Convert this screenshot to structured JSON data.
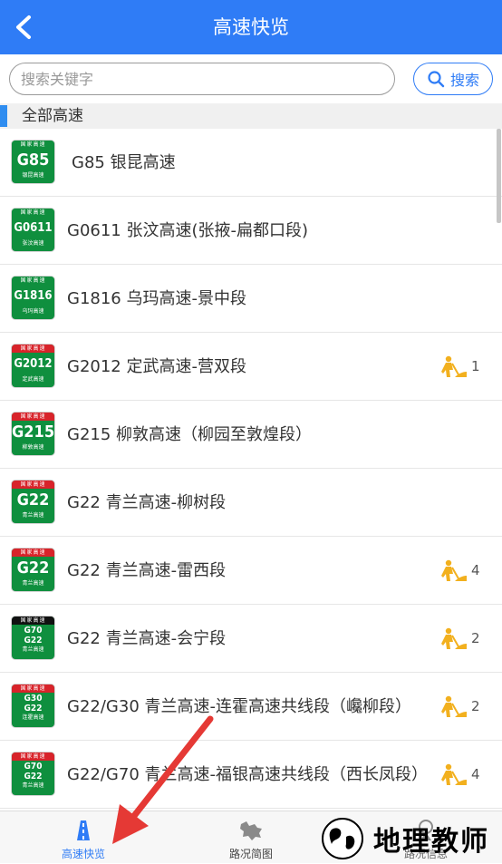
{
  "header": {
    "title": "高速快览",
    "back_icon": "chevron-left-icon"
  },
  "search": {
    "placeholder": "搜索关键字",
    "value": "",
    "button_label": "搜索"
  },
  "section": {
    "title": "全部高速"
  },
  "colors": {
    "primary": "#2f7cf6",
    "shield_green": "#0f8f3e",
    "shield_red": "#d8232a",
    "worker": "#f2b01e",
    "arrow": "#e53935"
  },
  "roads": [
    {
      "name": "G85 银昆高速",
      "badge_top": "国家高速",
      "badge_code": "G85",
      "badge_sub": "银昆高速",
      "incidents": ""
    },
    {
      "name": "G0611 张汶高速(张掖-扁都口段)",
      "badge_top": "国家高速",
      "badge_code": "G0611",
      "badge_sub": "张汶高速",
      "incidents": ""
    },
    {
      "name": "G1816 乌玛高速-景中段",
      "badge_top": "国家高速",
      "badge_code": "G1816",
      "badge_sub": "乌玛高速",
      "incidents": ""
    },
    {
      "name": "G2012 定武高速-营双段",
      "badge_top": "国家高速",
      "badge_code": "G2012",
      "badge_sub": "定武高速",
      "incidents": "1"
    },
    {
      "name": "G215 柳敦高速（柳园至敦煌段）",
      "badge_top": "国家高速",
      "badge_code": "G215",
      "badge_sub": "柳敦高速",
      "incidents": ""
    },
    {
      "name": "G22 青兰高速-柳树段",
      "badge_top": "国家高速",
      "badge_code": "G22",
      "badge_sub": "青兰高速",
      "incidents": ""
    },
    {
      "name": "G22 青兰高速-雷西段",
      "badge_top": "国家高速",
      "badge_code": "G22",
      "badge_sub": "青兰高速",
      "incidents": "4"
    },
    {
      "name": "G22 青兰高速-会宁段",
      "badge_top": "国家高速",
      "badge_code": "G70\nG22",
      "badge_sub": "青兰高速",
      "incidents": "2"
    },
    {
      "name": "G22/G30 青兰高速-连霍高速共线段（巉柳段）",
      "badge_top": "国家高速",
      "badge_code": "G30\nG22",
      "badge_sub": "连霍高速",
      "incidents": "2"
    },
    {
      "name": "G22/G70 青兰高速-福银高速共线段（西长凤段）",
      "badge_top": "国家高速",
      "badge_code": "G70\nG22",
      "badge_sub": "青兰高速",
      "incidents": "4"
    }
  ],
  "bottom_nav": [
    {
      "label": "高速快览",
      "icon": "road-icon",
      "active": true
    },
    {
      "label": "路况简图",
      "icon": "map-icon",
      "active": false
    },
    {
      "label": "路况信息",
      "icon": "info-icon",
      "active": false
    }
  ],
  "watermark": {
    "text": "地理教师"
  }
}
